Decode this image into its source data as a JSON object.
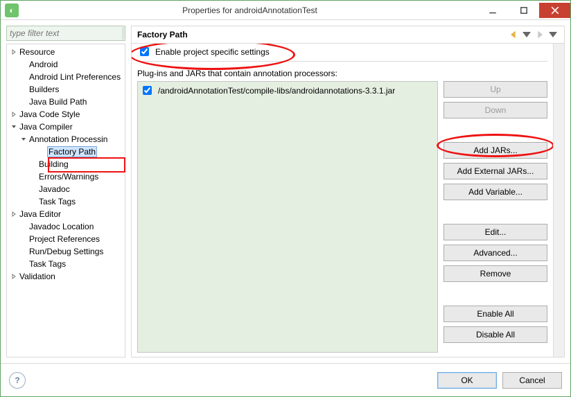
{
  "window": {
    "title": "Properties for androidAnnotationTest"
  },
  "filter": {
    "placeholder": "type filter text"
  },
  "tree": [
    {
      "label": "Resource",
      "indent": 0,
      "arrow": "right"
    },
    {
      "label": "Android",
      "indent": 1,
      "arrow": ""
    },
    {
      "label": "Android Lint Preferences",
      "indent": 1,
      "arrow": ""
    },
    {
      "label": "Builders",
      "indent": 1,
      "arrow": ""
    },
    {
      "label": "Java Build Path",
      "indent": 1,
      "arrow": ""
    },
    {
      "label": "Java Code Style",
      "indent": 0,
      "arrow": "right"
    },
    {
      "label": "Java Compiler",
      "indent": 0,
      "arrow": "down"
    },
    {
      "label": "Annotation Processin",
      "indent": 1,
      "arrow": "down"
    },
    {
      "label": "Factory Path",
      "indent": 3,
      "arrow": "",
      "selected": true
    },
    {
      "label": "Building",
      "indent": 2,
      "arrow": ""
    },
    {
      "label": "Errors/Warnings",
      "indent": 2,
      "arrow": ""
    },
    {
      "label": "Javadoc",
      "indent": 2,
      "arrow": ""
    },
    {
      "label": "Task Tags",
      "indent": 2,
      "arrow": ""
    },
    {
      "label": "Java Editor",
      "indent": 0,
      "arrow": "right"
    },
    {
      "label": "Javadoc Location",
      "indent": 1,
      "arrow": ""
    },
    {
      "label": "Project References",
      "indent": 1,
      "arrow": ""
    },
    {
      "label": "Run/Debug Settings",
      "indent": 1,
      "arrow": ""
    },
    {
      "label": "Task Tags",
      "indent": 1,
      "arrow": ""
    },
    {
      "label": "Validation",
      "indent": 0,
      "arrow": "right"
    }
  ],
  "page": {
    "title": "Factory Path",
    "enable_chk": "Enable project specific settings",
    "list_label": "Plug-ins and JARs that contain annotation processors:",
    "items": [
      {
        "path": "/androidAnnotationTest/compile-libs/androidannotations-3.3.1.jar",
        "checked": true
      }
    ],
    "buttons": {
      "up": "Up",
      "down": "Down",
      "add_jars": "Add JARs...",
      "add_ext": "Add External JARs...",
      "add_var": "Add Variable...",
      "edit": "Edit...",
      "advanced": "Advanced...",
      "remove": "Remove",
      "enable_all": "Enable All",
      "disable_all": "Disable All"
    }
  },
  "footer": {
    "ok": "OK",
    "cancel": "Cancel"
  }
}
